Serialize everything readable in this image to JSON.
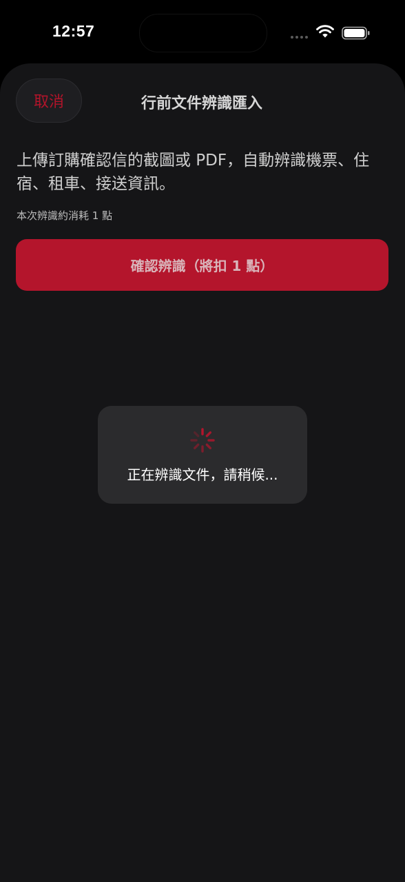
{
  "status_bar": {
    "time": "12:57",
    "icons": [
      "signal-icon",
      "wifi-icon",
      "battery-icon"
    ]
  },
  "header": {
    "cancel_label": "取消",
    "title": "行前文件辨識匯入"
  },
  "content": {
    "description": "上傳訂購確認信的截圖或 PDF，自動辨識機票、住宿、租車、接送資訊。",
    "cost_note": "本次辨識約消耗 1 點",
    "confirm_label": "確認辨識（將扣 1 點）"
  },
  "loading": {
    "icon": "spinner-icon",
    "message": "正在辨識文件，請稍候..."
  },
  "colors": {
    "accent": "#b4152c",
    "background": "#151517",
    "overlay": "#2b2b2d"
  }
}
